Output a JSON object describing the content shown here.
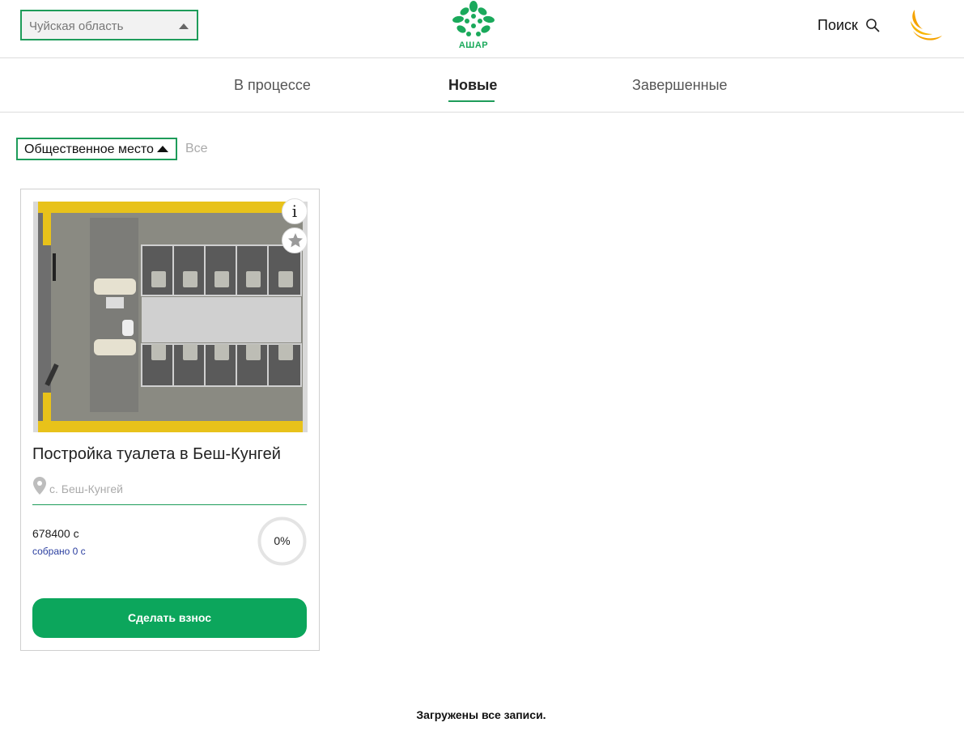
{
  "header": {
    "region_select": {
      "value": "Чуйская область"
    },
    "logo": {
      "text": "АШАР",
      "icon": "ashar-tree-logo",
      "color": "#1aa95b"
    },
    "search": {
      "label": "Поиск",
      "icon": "search-icon"
    },
    "partner_logo_icon": "sun-logo"
  },
  "tabs": [
    {
      "label": "В процессе",
      "active": false
    },
    {
      "label": "Новые",
      "active": true
    },
    {
      "label": "Завершенные",
      "active": false
    }
  ],
  "filter": {
    "category": "Общественное место",
    "all_label": "Все"
  },
  "cards": [
    {
      "title": "Постройка туалета в Беш-Кунгей",
      "location": "с. Беш-Кунгей",
      "goal": "678400 с",
      "collected": "собрано 0 с",
      "progress_label": "0%",
      "progress_fraction": 0,
      "button_label": "Сделать взнос",
      "info_label": "i",
      "info_icon": "info-icon",
      "favorite_icon": "star-icon"
    }
  ],
  "footer": {
    "message": "Загружены все записи."
  },
  "colors": {
    "accent": "#1e9c5a",
    "button": "#0ca65c",
    "link": "#2b3fa0",
    "logo_orange": "#f5a300"
  }
}
